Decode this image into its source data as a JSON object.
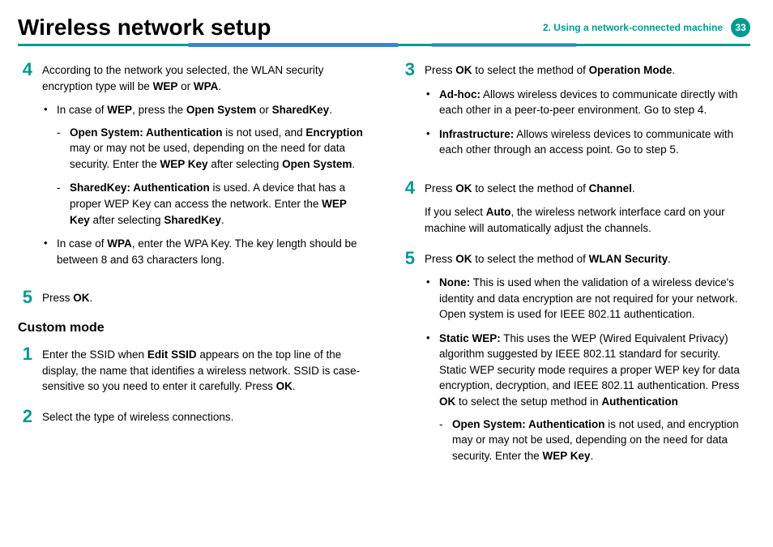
{
  "header": {
    "title": "Wireless network setup",
    "chapter": "2.  Using a network-connected machine",
    "page_number": "33"
  },
  "left": {
    "step4": {
      "num": "4",
      "intro_a": "According to the network you selected, the WLAN security encryption type will be ",
      "wep_b": "WEP",
      "or": " or ",
      "wpa_b": "WPA",
      "dot": ".",
      "bullet_wep_a": "In case of ",
      "bullet_wep_b": "WEP",
      "bullet_wep_c": ", press the ",
      "bullet_wep_d": "Open System",
      "bullet_wep_e": " or ",
      "bullet_wep_f": "SharedKey",
      "bullet_wep_g": ".",
      "open_sys_a": "Open System: Authentication",
      "open_sys_b": " is not used, and ",
      "open_sys_c": "Encryption",
      "open_sys_d": " may or may not be used, depending on the need for data security. Enter the ",
      "open_sys_e": "WEP Key",
      "open_sys_f": " after selecting ",
      "open_sys_g": "Open System",
      "open_sys_h": ".",
      "shared_a": "SharedKey: Authentication",
      "shared_b": " is used. A device that has a proper WEP Key can access the network. Enter the ",
      "shared_c": "WEP Key",
      "shared_d": " after selecting ",
      "shared_e": "SharedKey",
      "shared_f": ".",
      "bullet_wpa_a": "In case of ",
      "bullet_wpa_b": "WPA",
      "bullet_wpa_c": ", enter the WPA Key. The key length should be between 8 and 63 characters long."
    },
    "step5": {
      "num": "5",
      "text_a": "Press ",
      "text_b": "OK",
      "text_c": "."
    },
    "subheading": "Custom mode",
    "c_step1": {
      "num": "1",
      "text_a": "Enter the SSID when ",
      "text_b": "Edit SSID",
      "text_c": " appears on the top line of the display, the name that identifies a wireless network. SSID is case-sensitive so you need to enter it carefully. Press ",
      "text_d": "OK",
      "text_e": "."
    },
    "c_step2": {
      "num": "2",
      "text": "Select the type of wireless connections."
    }
  },
  "right": {
    "step3": {
      "num": "3",
      "text_a": "Press ",
      "text_b": "OK",
      "text_c": " to select the method of ",
      "text_d": "Operation Mode",
      "text_e": ".",
      "adhoc_a": "Ad-hoc:",
      "adhoc_b": " Allows wireless devices to communicate directly with each other in a peer-to-peer environment. Go to step 4.",
      "infra_a": "Infrastructure:",
      "infra_b": " Allows wireless devices to communicate with each other through an access point. Go to step 5."
    },
    "step4": {
      "num": "4",
      "text_a": "Press ",
      "text_b": "OK",
      "text_c": " to select the method of ",
      "text_d": "Channel",
      "text_e": ".",
      "p2_a": "If you select ",
      "p2_b": "Auto",
      "p2_c": ", the wireless network interface card on your machine will automatically adjust the channels."
    },
    "step5": {
      "num": "5",
      "text_a": "Press ",
      "text_b": "OK",
      "text_c": " to select the method of ",
      "text_d": "WLAN Security",
      "text_e": ".",
      "none_a": "None:",
      "none_b": " This is used when the validation of a wireless device's identity and data encryption are not required for your network. Open system is used for IEEE 802.11 authentication.",
      "static_a": "Static WEP:",
      "static_b": " This uses the WEP (Wired Equivalent Privacy) algorithm suggested by IEEE 802.11 standard for security. Static WEP security mode requires a proper WEP key for data encryption, decryption, and IEEE 802.11 authentication. Press ",
      "static_c": "OK",
      "static_d": " to select the setup method in ",
      "static_e": "Authentication",
      "open_a": "Open System: Authentication",
      "open_b": " is not used, and encryption may or may not be used, depending on the need for data security. Enter the ",
      "open_c": "WEP Key",
      "open_d": "."
    }
  }
}
